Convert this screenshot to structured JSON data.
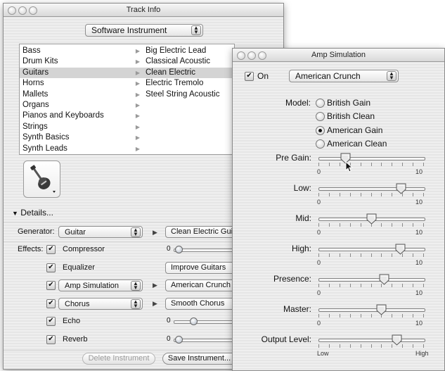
{
  "track_info": {
    "title": "Track Info",
    "instrument_type": "Software Instrument",
    "categories": [
      {
        "label": "Bass"
      },
      {
        "label": "Drum Kits"
      },
      {
        "label": "Guitars"
      },
      {
        "label": "Horns"
      },
      {
        "label": "Mallets"
      },
      {
        "label": "Organs"
      },
      {
        "label": "Pianos and Keyboards"
      },
      {
        "label": "Strings"
      },
      {
        "label": "Synth Basics"
      },
      {
        "label": "Synth Leads"
      }
    ],
    "selected_category": "Guitars",
    "instruments": [
      {
        "label": "Big Electric Lead"
      },
      {
        "label": "Classical Acoustic"
      },
      {
        "label": "Clean Electric"
      },
      {
        "label": "Electric Tremolo"
      },
      {
        "label": "Steel String Acoustic"
      }
    ],
    "selected_instrument": "Clean Electric",
    "details_label": "Details...",
    "generator_label": "Generator:",
    "generator_value": "Guitar",
    "generator_preset": "Clean Electric Guita",
    "effects_label": "Effects:",
    "effects": [
      {
        "name": "Compressor",
        "checked": true,
        "control": "slider",
        "value_label": "0",
        "level": 0.02
      },
      {
        "name": "Equalizer",
        "checked": true,
        "control": "preset",
        "preset": "Improve Guitars"
      },
      {
        "name": "Amp Simulation",
        "checked": true,
        "control": "popup",
        "preset": "American Crunch"
      },
      {
        "name": "Chorus",
        "checked": true,
        "control": "popup",
        "preset": "Smooth Chorus"
      },
      {
        "name": "Echo",
        "checked": true,
        "control": "slider",
        "value_label": "0",
        "level": 0.25
      },
      {
        "name": "Reverb",
        "checked": true,
        "control": "slider",
        "value_label": "0",
        "level": 0.02
      }
    ],
    "delete_button": "Delete Instrument",
    "save_button": "Save Instrument..."
  },
  "amp": {
    "title": "Amp Simulation",
    "on_label": "On",
    "on_checked": true,
    "preset": "American Crunch",
    "model_label": "Model:",
    "models": [
      {
        "label": "British Gain",
        "selected": false
      },
      {
        "label": "British Clean",
        "selected": false
      },
      {
        "label": "American Gain",
        "selected": true
      },
      {
        "label": "American Clean",
        "selected": false
      }
    ],
    "params": [
      {
        "label": "Pre Gain:",
        "min_label": "0",
        "max_label": "10",
        "value": 2.5
      },
      {
        "label": "Low:",
        "min_label": "0",
        "max_label": "10",
        "value": 7.8
      },
      {
        "label": "Mid:",
        "min_label": "0",
        "max_label": "10",
        "value": 5.0
      },
      {
        "label": "High:",
        "min_label": "0",
        "max_label": "10",
        "value": 7.7
      },
      {
        "label": "Presence:",
        "min_label": "0",
        "max_label": "10",
        "value": 6.2
      },
      {
        "label": "Master:",
        "min_label": "0",
        "max_label": "10",
        "value": 5.9
      },
      {
        "label": "Output Level:",
        "min_label": "Low",
        "max_label": "High",
        "value": 7.4
      }
    ]
  }
}
